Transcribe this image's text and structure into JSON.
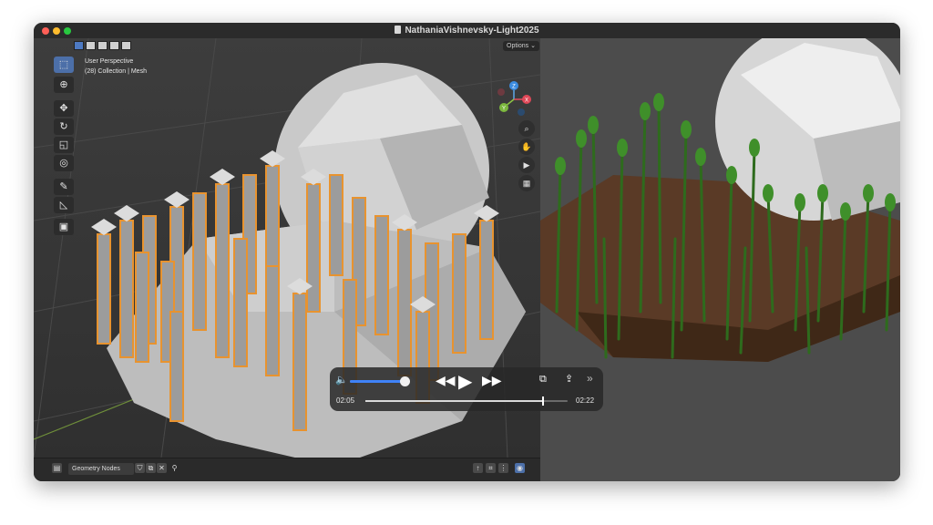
{
  "window": {
    "title": "NathaniaVishnevsky-Light2025"
  },
  "viewport": {
    "options_label": "Options",
    "perspective": "User Perspective",
    "collection": "(28) Collection | Mesh",
    "tools": [
      "select-box-icon",
      "cursor-icon",
      "move-icon",
      "rotate-icon",
      "scale-icon",
      "transform-icon",
      "annotate-icon",
      "measure-icon",
      "add-cube-icon"
    ],
    "gizmo": {
      "x": "X",
      "y": "Y",
      "z": "Z"
    },
    "nav_buttons": [
      "zoom-icon",
      "pan-hand-icon",
      "camera-icon",
      "grid-icon"
    ]
  },
  "bottom_bar": {
    "editor_label": "Geometry Nodes"
  },
  "player": {
    "current_time": "02:05",
    "total_time": "02:22",
    "progress": 0.88,
    "volume": 1.0
  },
  "colors": {
    "accent": "#3f82f7",
    "selection": "#e8932f"
  }
}
